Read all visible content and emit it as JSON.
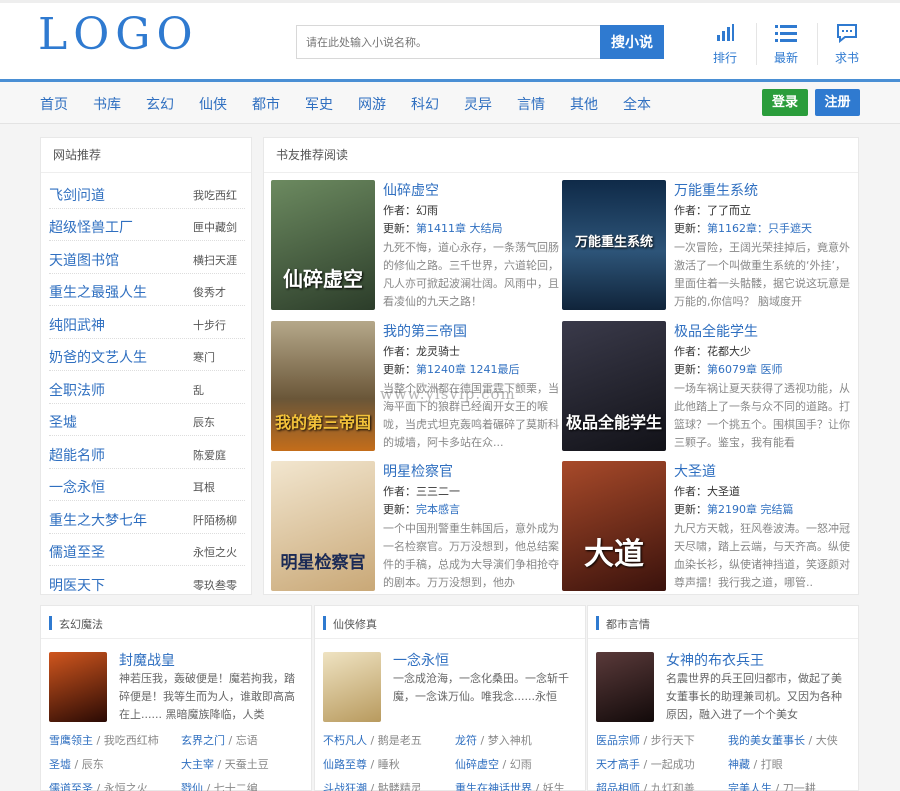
{
  "header": {
    "logo": "LOGO",
    "search_placeholder": "请在此处输入小说名称。",
    "search_button": "搜小说",
    "links": [
      {
        "label": "排行",
        "icon": "bar-chart-icon"
      },
      {
        "label": "最新",
        "icon": "list-icon"
      },
      {
        "label": "求书",
        "icon": "chat-icon"
      }
    ]
  },
  "nav": {
    "items": [
      "首页",
      "书库",
      "玄幻",
      "仙侠",
      "都市",
      "军史",
      "网游",
      "科幻",
      "灵异",
      "言情",
      "其他",
      "全本"
    ],
    "login": "登录",
    "register": "注册"
  },
  "site_recommend": {
    "title": "网站推荐",
    "items": [
      {
        "title": "飞剑问道",
        "author": "我吃西红"
      },
      {
        "title": "超级怪兽工厂",
        "author": "匣中藏剑"
      },
      {
        "title": "天道图书馆",
        "author": "横扫天涯"
      },
      {
        "title": "重生之最强人生",
        "author": "俊秀才"
      },
      {
        "title": "纯阳武神",
        "author": "十步行"
      },
      {
        "title": "奶爸的文艺人生",
        "author": "寒门"
      },
      {
        "title": "全职法师",
        "author": "乱"
      },
      {
        "title": "圣墟",
        "author": "辰东"
      },
      {
        "title": "超能名师",
        "author": "陈爱庭"
      },
      {
        "title": "一念永恒",
        "author": "耳根"
      },
      {
        "title": "重生之大梦七年",
        "author": "阡陌杨柳"
      },
      {
        "title": "儒道至圣",
        "author": "永恒之火"
      },
      {
        "title": "明医天下",
        "author": "零玖叁零"
      }
    ]
  },
  "reader_recommend": {
    "title": "书友推荐阅读",
    "author_prefix": "作者：",
    "update_prefix": "更新：",
    "books": [
      {
        "title": "仙碎虚空",
        "author": "幻雨",
        "update": "第1411章 大结局",
        "desc": "九死不悔，道心永存，一条荡气回肠的修仙之路。三千世界，六道轮回，凡人亦可掀起波澜壮阔。风雨中，且看凌仙的九天之路！",
        "cover_text": "仙碎虚空",
        "cover_color": "#3f5a3a"
      },
      {
        "title": "万能重生系统",
        "author": "了了而立",
        "update": "第1162章：只手遮天",
        "desc": "一次冒险，王阔光荣挂掉后，竟意外激活了一个叫做重生系统的‘外挂’，里面住着一头骷髅，据它说这玩意是万能的,你信吗？ 脑域度开",
        "cover_text": "万能重生系统",
        "cover_color": "#1e3a5c"
      },
      {
        "title": "我的第三帝国",
        "author": "龙灵骑士",
        "update": "第1240章 1241最后",
        "desc": "当整个欧洲都在德国雷霆下颤栗，当海平面下的狼群已经阖开女王的喉咙，当虎式坦克轰鸣着碾碎了莫斯科的城墙，阿卡多站在众...",
        "cover_text": "我的第三帝国",
        "cover_color": "#5a4a30"
      },
      {
        "title": "极品全能学生",
        "author": "花都大少",
        "update": "第6079章 医师",
        "desc": "一场车祸让夏天获得了透视功能，从此他踏上了一条与众不同的道路。打篮球？一个挑五个。围棋国手？让你三颗子。鉴宝，我有能看",
        "cover_text": "极品全能学生",
        "cover_color": "#2a2a3a"
      },
      {
        "title": "明星检察官",
        "author": "三三二一",
        "update": "完本感言",
        "desc": "一个中国刑警重生韩国后，意外成为一名检察官。万万没想到，他总结案件的手稿，总成为大导演们争相抢夺的剧本。万万没想到，他办",
        "cover_text": "明星检察官",
        "cover_color": "#c9a877"
      },
      {
        "title": "大圣道",
        "author": "大圣道",
        "update": "第2190章 完结篇",
        "desc": "九尺方天戟，狂风卷波涛。一怒冲冠天尽啸，踏上云端，与天齐高。纵使血染长衫，纵使诸神挡道，笑逐颜对尊声擂！我行我之道，哪管..",
        "cover_text": "大道",
        "cover_color": "#6b2a1e"
      }
    ]
  },
  "watermark": "www.ylsvip.com",
  "categories": [
    {
      "name": "玄幻魔法",
      "featured": {
        "title": "封魔战皇",
        "desc": "神若压我，轰破便是！魔若拘我，踏碎便是！我等生而为人，谁敢即高高在上...... 黑暗魔族降临，人类",
        "cover_color": "#8a2a12"
      },
      "items": [
        {
          "title": "雪鹰领主",
          "author": "我吃西红柿"
        },
        {
          "title": "玄界之门",
          "author": "忘语"
        },
        {
          "title": "圣墟",
          "author": "辰东"
        },
        {
          "title": "大主宰",
          "author": "天蚕土豆"
        },
        {
          "title": "儒道至圣",
          "author": "永恒之火"
        },
        {
          "title": "戮仙",
          "author": "七十二编"
        }
      ]
    },
    {
      "name": "仙侠修真",
      "featured": {
        "title": "一念永恒",
        "desc": "一念成沧海，一念化桑田。一念斩千魔，一念诛万仙。唯我念......永恒",
        "cover_color": "#c7b07a"
      },
      "items": [
        {
          "title": "不朽凡人",
          "author": "鹅是老五"
        },
        {
          "title": "龙符",
          "author": "梦入神机"
        },
        {
          "title": "仙路至尊",
          "author": "睡秋"
        },
        {
          "title": "仙碎虚空",
          "author": "幻雨"
        },
        {
          "title": "斗战狂潮",
          "author": "骷髅精灵"
        },
        {
          "title": "重生在神话世界",
          "author": "妖生"
        }
      ]
    },
    {
      "name": "都市言情",
      "featured": {
        "title": "女神的布衣兵王",
        "desc": "名震世界的兵王回归都市，做起了美女董事长的助理兼司机。又因为各种原因，融入进了一个个美女",
        "cover_color": "#3a2a2a"
      },
      "items": [
        {
          "title": "医品宗师",
          "author": "步行天下"
        },
        {
          "title": "我的美女董事长",
          "author": "大侠"
        },
        {
          "title": "天才高手",
          "author": "一起成功"
        },
        {
          "title": "神藏",
          "author": "打眼"
        },
        {
          "title": "超品相师",
          "author": "九灯和善"
        },
        {
          "title": "完美人生",
          "author": "刀一耕"
        }
      ]
    }
  ]
}
